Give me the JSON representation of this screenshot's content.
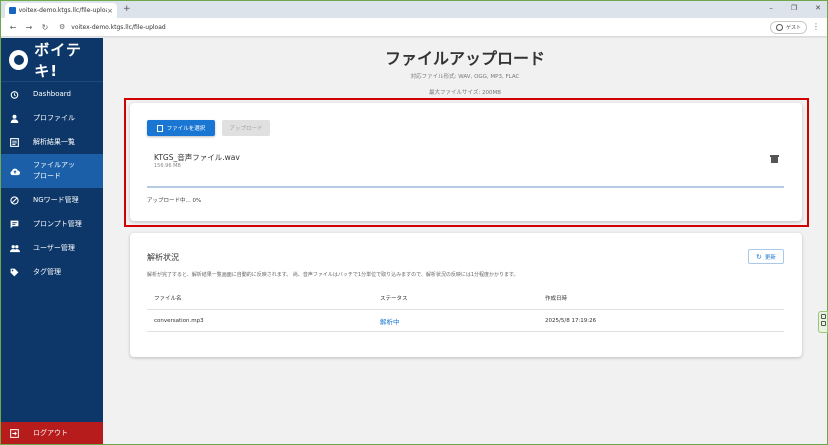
{
  "browser": {
    "tab_title": "voitex-demo.ktgs.llc/file-upload",
    "new_tab": "+",
    "url": "voitex-demo.ktgs.llc/file-upload",
    "profile_label": "ゲスト",
    "window_minimize": "–",
    "window_restore": "❐",
    "window_close": "✕",
    "tab_close": "×"
  },
  "sidebar": {
    "logo_text": "ボイテキ!",
    "items": [
      {
        "label": "Dashboard",
        "icon": "alarm-clock-icon"
      },
      {
        "label": "プロファイル",
        "icon": "person-icon"
      },
      {
        "label": "解析結果一覧",
        "icon": "list-icon"
      },
      {
        "label": "ファイルアップロード",
        "icon": "cloud-upload-icon"
      },
      {
        "label": "NGワード管理",
        "icon": "block-icon"
      },
      {
        "label": "プロンプト管理",
        "icon": "chat-icon"
      },
      {
        "label": "ユーザー管理",
        "icon": "group-icon"
      },
      {
        "label": "タグ管理",
        "icon": "tag-icon"
      }
    ],
    "logout_label": "ログアウト"
  },
  "main": {
    "title": "ファイルアップロード",
    "supported_formats": "対応ファイル形式: WAV, OGG, MP3, FLAC",
    "max_size": "最大ファイルサイズ: 200MB"
  },
  "upload": {
    "select_button": "ファイルを選択",
    "upload_button": "アップロード",
    "file_name": "KTGS_音声ファイル.wav",
    "file_size": "156.96 MB",
    "progress_percent": 0,
    "progress_text": "アップロード中... 0%"
  },
  "status": {
    "title": "解析状況",
    "refresh_button": "更新",
    "note": "解析が完了すると、解析結果一覧画面に自動的に反映されます。 尚、音声ファイルはバッチで1分単位で取り込みますので、解析状況の反映には1分程度かかります。",
    "columns": [
      "ファイル名",
      "ステータス",
      "作成日時"
    ],
    "rows": [
      {
        "file": "conversation.mp3",
        "status": "解析中",
        "created": "2025/5/8 17:19:26"
      }
    ]
  },
  "colors": {
    "sidebar_bg": "#0d3768",
    "active_item": "#1b5fa8",
    "primary": "#1976d2",
    "logout_bg": "#b71c1c",
    "highlight_border": "#d00000"
  }
}
